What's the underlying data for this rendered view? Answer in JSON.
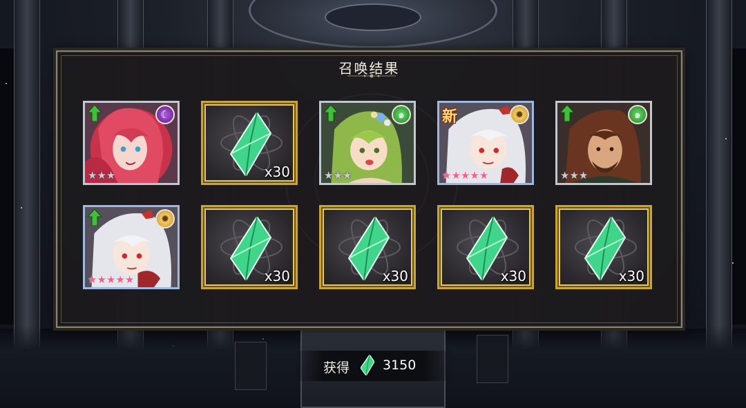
{
  "panel": {
    "title": "召唤结果"
  },
  "results": [
    {
      "kind": "hero",
      "slot": "r1c1",
      "upgrade": true,
      "element": "dark-moon-icon",
      "element_glyph": "☾",
      "rarity_stars": 3,
      "is_new": false
    },
    {
      "kind": "crystal",
      "slot": "r1c2",
      "quantity": "x30"
    },
    {
      "kind": "hero",
      "slot": "r1c3",
      "upgrade": true,
      "element": "wind-swirl-icon",
      "element_glyph": "๑",
      "rarity_stars": 3,
      "is_new": false
    },
    {
      "kind": "hero",
      "slot": "r1c4",
      "upgrade": false,
      "element": "light-sun-icon",
      "element_glyph": "✹",
      "rarity_stars": 5,
      "is_new": true,
      "new_label": "新"
    },
    {
      "kind": "hero",
      "slot": "r1c5",
      "upgrade": true,
      "element": "wind-swirl-icon",
      "element_glyph": "๑",
      "rarity_stars": 3,
      "is_new": false
    },
    {
      "kind": "hero",
      "slot": "r2c1",
      "upgrade": true,
      "element": "light-sun-icon",
      "element_glyph": "✹",
      "rarity_stars": 5,
      "is_new": false
    },
    {
      "kind": "crystal",
      "slot": "r2c2",
      "quantity": "x30"
    },
    {
      "kind": "crystal",
      "slot": "r2c3",
      "quantity": "x30"
    },
    {
      "kind": "crystal",
      "slot": "r2c4",
      "quantity": "x30"
    },
    {
      "kind": "crystal",
      "slot": "r2c5",
      "quantity": "x30"
    }
  ],
  "obtain": {
    "label": "获得",
    "value": "3150",
    "icon": "green-crystal-icon"
  },
  "colors": {
    "crystal_green": "#3fd58a",
    "frame_gold": "#c9a43a",
    "panel_border": "#8d8375",
    "upgrade_green": "#3fbf3a"
  }
}
